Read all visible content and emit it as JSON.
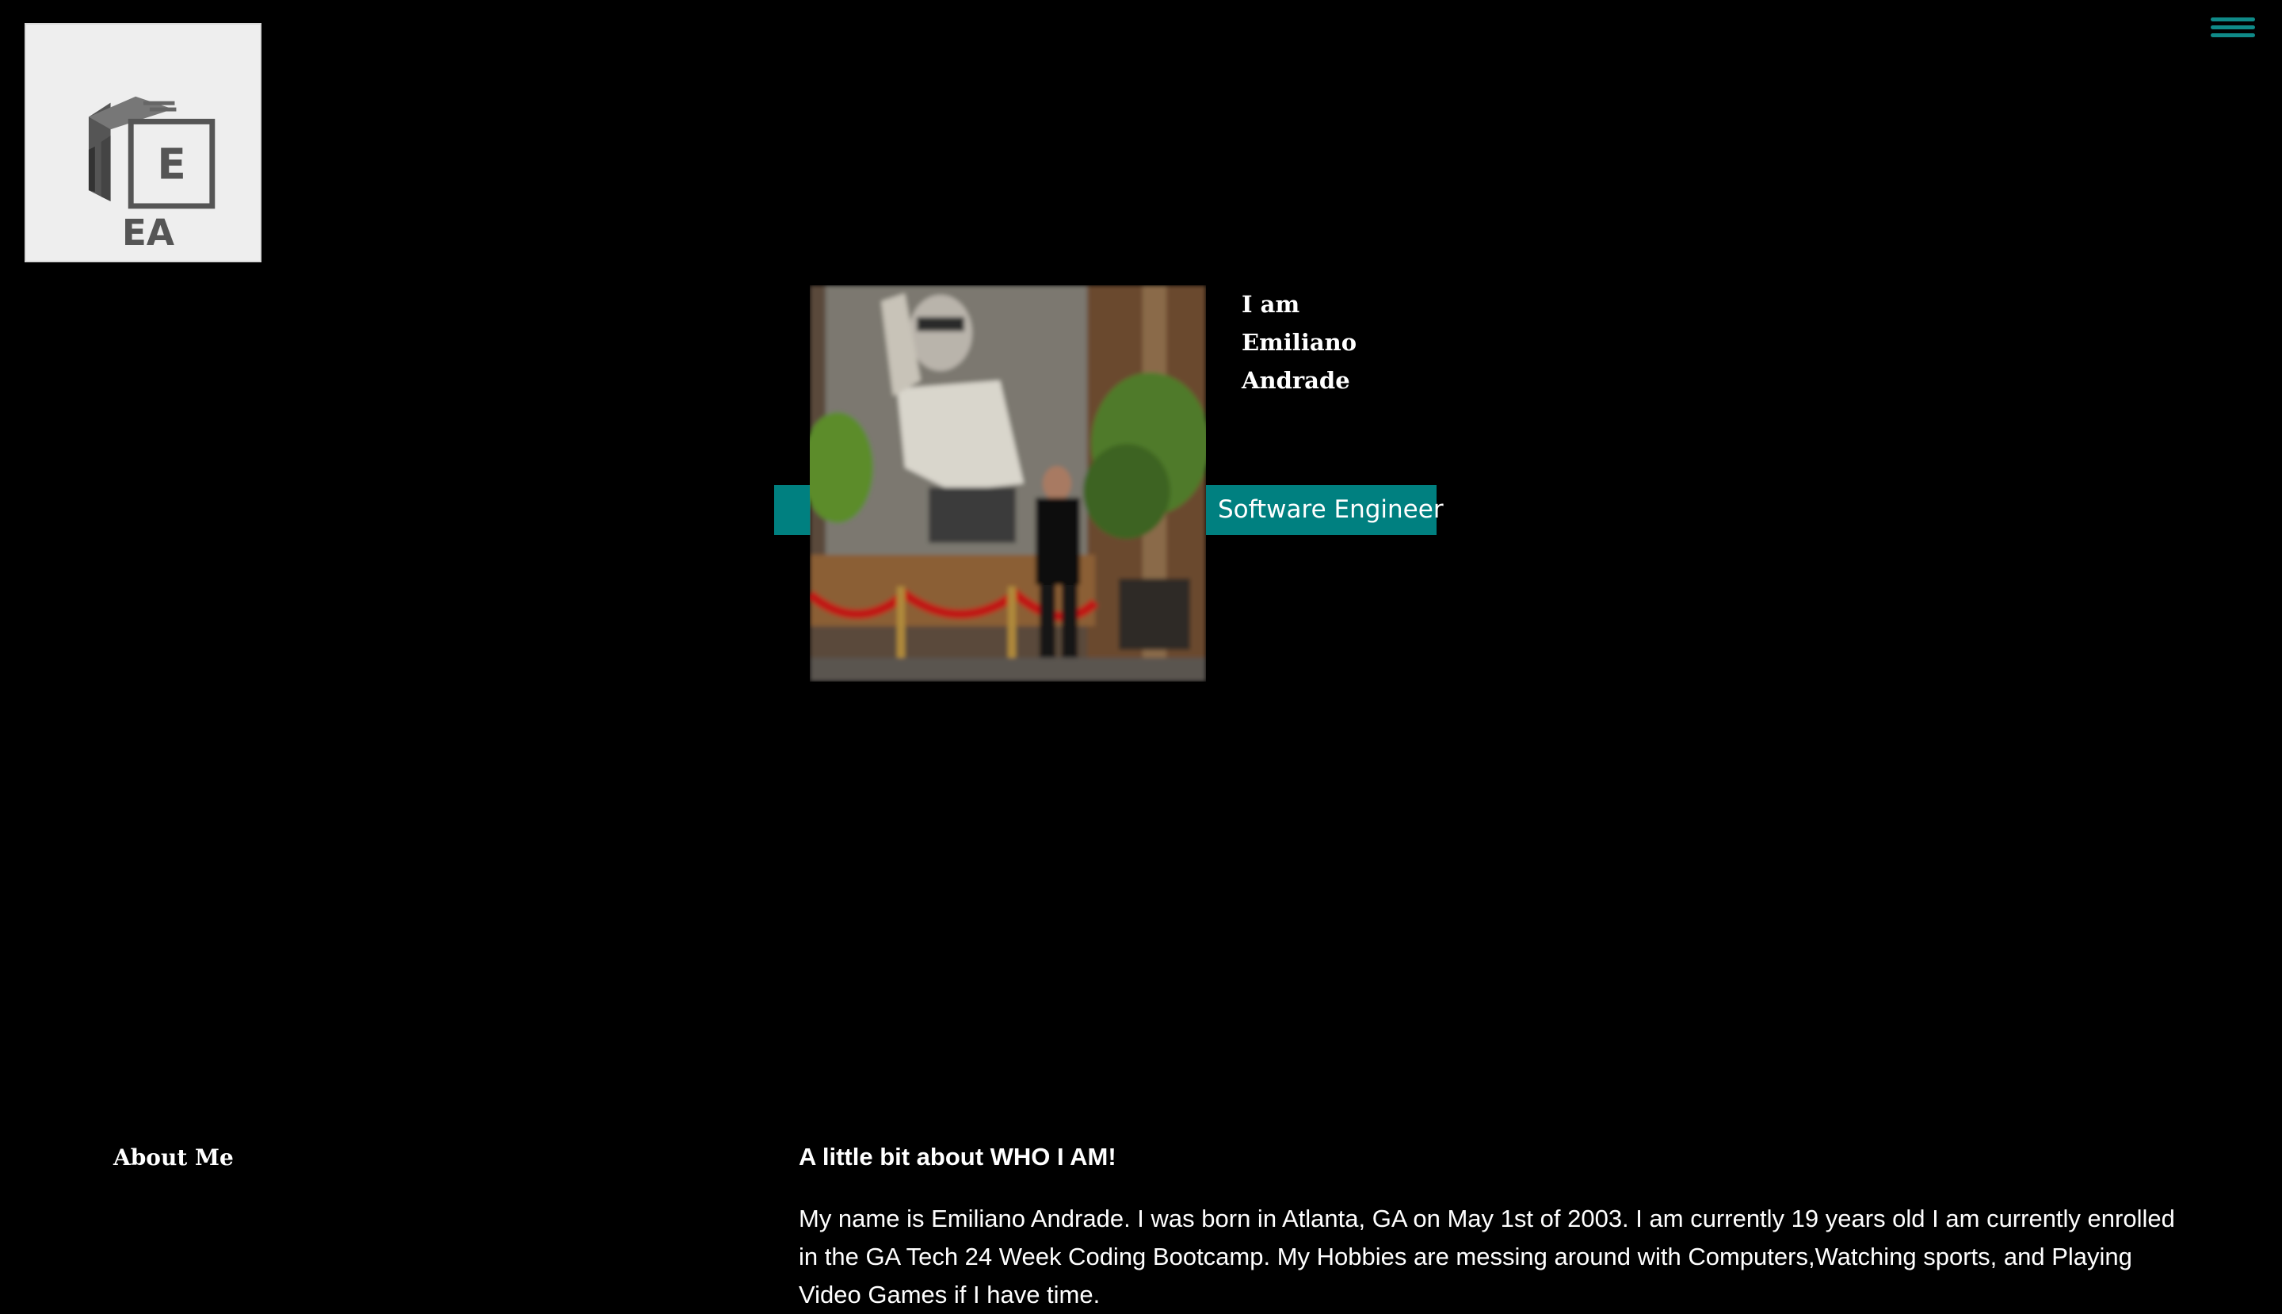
{
  "logo": {
    "letter": "E",
    "initials": "EA",
    "icon": "cube-logo-icon"
  },
  "nav": {
    "menu_icon": "hamburger-menu-icon",
    "menu_color": "#0f8a88"
  },
  "hero": {
    "intro": "I am Emiliano Andrade",
    "role": "Software Engineer",
    "accent_color": "#008080",
    "photo_icon": "profile-photo"
  },
  "about": {
    "heading": "About Me",
    "subheading": "A little bit about WHO I AM!",
    "body": "My name is Emiliano Andrade. I was born in Atlanta, GA on May 1st of 2003. I am currently 19 years old I am currently enrolled in the GA Tech 24 Week Coding Bootcamp. My Hobbies are messing around with Computers,Watching sports, and Playing Video Games if I have time."
  }
}
